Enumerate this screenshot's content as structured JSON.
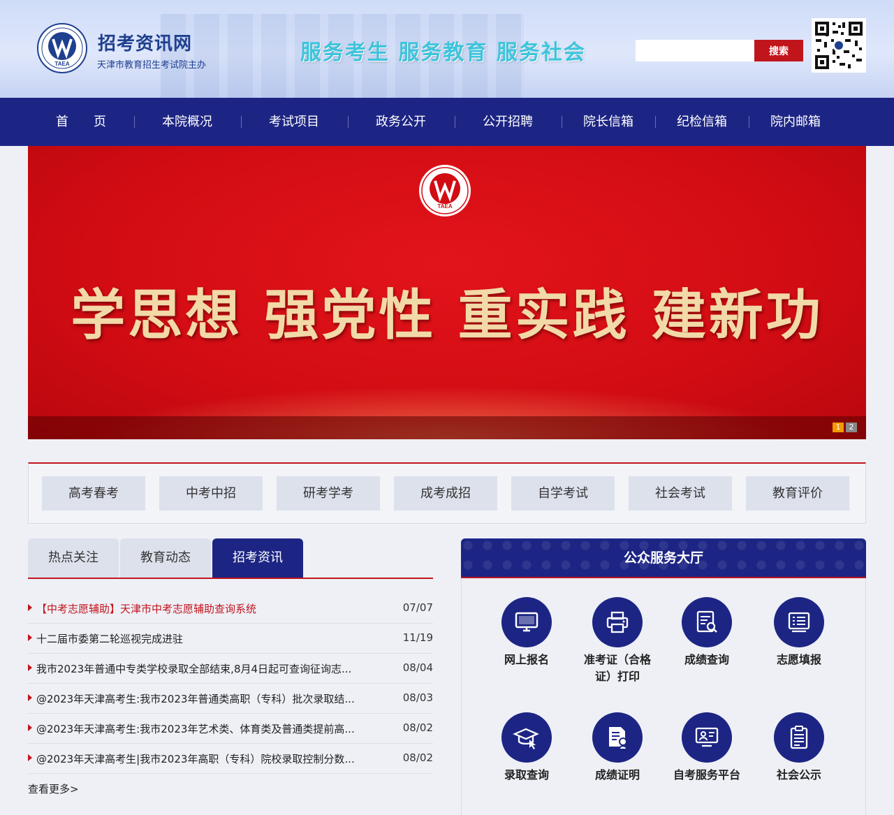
{
  "header": {
    "title": "招考资讯网",
    "subtitle": "天津市教育招生考试院主办",
    "logo_text": "TAEA",
    "slogan": "服务考生  服务教育  服务社会",
    "search": {
      "placeholder": "",
      "button_label": "搜索"
    },
    "qr_icon": "qr-code-icon"
  },
  "nav": {
    "items": [
      "首　　页",
      "本院概况",
      "考试项目",
      "政务公开",
      "公开招聘",
      "院长信箱",
      "纪检信箱",
      "院内邮箱"
    ]
  },
  "banner": {
    "headline": "学思想  强党性  重实践  建新功",
    "logo_text": "TAEA",
    "pagination": [
      "1",
      "2"
    ],
    "active_page": "1",
    "colors": {
      "background": "#d20c13",
      "text": "#f2d9a8"
    }
  },
  "categories": [
    "高考春考",
    "中考中招",
    "研考学考",
    "成考成招",
    "自学考试",
    "社会考试",
    "教育评价"
  ],
  "news": {
    "tabs": [
      "热点关注",
      "教育动态",
      "招考资讯"
    ],
    "active_tab": "招考资讯",
    "items": [
      {
        "title": "【中考志愿辅助】天津市中考志愿辅助查询系统",
        "date": "07/07",
        "highlight": true
      },
      {
        "title": "十二届市委第二轮巡视完成进驻",
        "date": "11/19",
        "highlight": false
      },
      {
        "title": "我市2023年普通中专类学校录取全部结束,8月4日起可查询征询志...",
        "date": "08/04",
        "highlight": false
      },
      {
        "title": "@2023年天津高考生:我市2023年普通类高职（专科）批次录取结...",
        "date": "08/03",
        "highlight": false
      },
      {
        "title": "@2023年天津高考生:我市2023年艺术类、体育类及普通类提前高...",
        "date": "08/02",
        "highlight": false
      },
      {
        "title": "@2023年天津高考生|我市2023年高职（专科）院校录取控制分数...",
        "date": "08/02",
        "highlight": false
      }
    ],
    "more_label": "查看更多>"
  },
  "services": {
    "title": "公众服务大厅",
    "items": [
      {
        "label": "网上报名",
        "icon": "monitor-icon"
      },
      {
        "label": "准考证（合格证）打印",
        "icon": "printer-icon"
      },
      {
        "label": "成绩查询",
        "icon": "report-search-icon"
      },
      {
        "label": "志愿填报",
        "icon": "form-list-icon"
      },
      {
        "label": "录取查询",
        "icon": "graduation-cap-icon"
      },
      {
        "label": "成绩证明",
        "icon": "certificate-icon"
      },
      {
        "label": "自考服务平台",
        "icon": "teaching-screen-icon"
      },
      {
        "label": "社会公示",
        "icon": "clipboard-icon"
      }
    ]
  },
  "colors": {
    "primary": "#1d2584",
    "accent": "#c1151c",
    "slogan": "#3ec4dc"
  }
}
